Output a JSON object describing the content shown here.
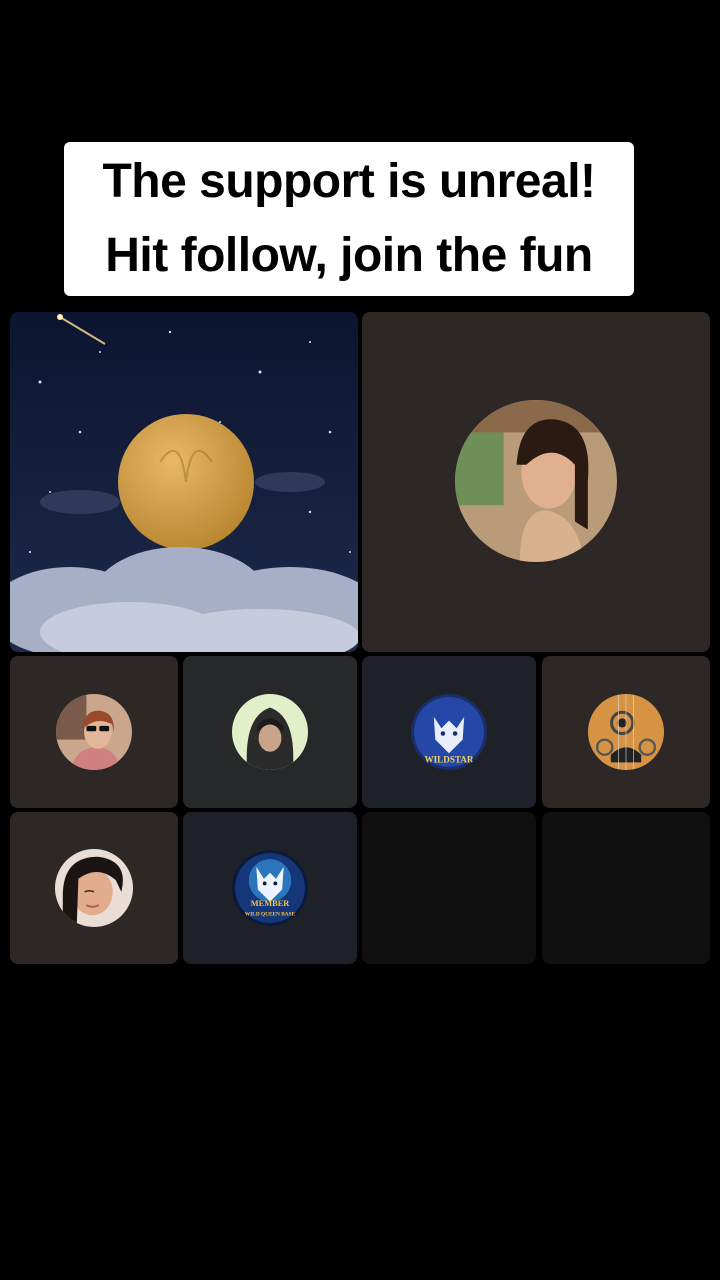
{
  "caption": {
    "line1": "The support is unreal!",
    "line2": "Hit follow, join the fun"
  },
  "tiles": [
    {
      "id": "slot-1",
      "kind": "animated-scene",
      "description_icon": "moon-night-sky-icon",
      "occupied": true
    },
    {
      "id": "slot-2",
      "kind": "avatar",
      "avatar_icon": "woman-portrait-avatar",
      "occupied": true
    },
    {
      "id": "slot-3",
      "kind": "avatar",
      "avatar_icon": "woman-sunglasses-avatar",
      "occupied": true
    },
    {
      "id": "slot-4",
      "kind": "avatar",
      "avatar_icon": "hooded-person-avatar",
      "occupied": true
    },
    {
      "id": "slot-5",
      "kind": "avatar",
      "avatar_icon": "wolf-logo-avatar",
      "badge_text": "WILDSTAR",
      "occupied": true
    },
    {
      "id": "slot-6",
      "kind": "avatar",
      "avatar_icon": "guitar-avatar",
      "occupied": true
    },
    {
      "id": "slot-7",
      "kind": "avatar",
      "avatar_icon": "woman-selfie-avatar",
      "occupied": true
    },
    {
      "id": "slot-8",
      "kind": "avatar",
      "avatar_icon": "wolf-member-logo-avatar",
      "badge_text": "MEMBER",
      "badge_subtext": "WILD QUEEN BASE",
      "occupied": true
    },
    {
      "id": "slot-9",
      "kind": "empty",
      "occupied": false
    },
    {
      "id": "slot-10",
      "kind": "empty",
      "occupied": false
    }
  ],
  "colors": {
    "background": "#000000",
    "caption_bg": "#ffffff",
    "tile_brown": "#2d2826",
    "tile_gray": "#26282a",
    "tile_navy": "#1e2128",
    "tile_empty": "#101010"
  }
}
